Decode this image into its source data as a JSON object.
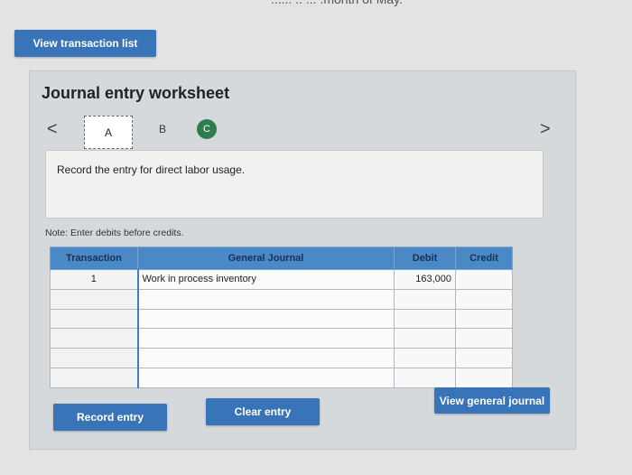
{
  "header": {
    "partial_text": "...... .. ... .month of May."
  },
  "view_list_button": "View transaction list",
  "worksheet": {
    "title": "Journal entry worksheet",
    "tabs": [
      "A",
      "B",
      "C"
    ],
    "prev_arrow": "<",
    "next_arrow": ">",
    "instruction": "Record the entry for direct labor usage.",
    "note": "Note: Enter debits before credits."
  },
  "table": {
    "headers": {
      "transaction": "Transaction",
      "journal": "General Journal",
      "debit": "Debit",
      "credit": "Credit"
    },
    "rows": [
      {
        "transaction": "1",
        "journal": "Work in process inventory",
        "debit": "163,000",
        "credit": ""
      },
      {
        "transaction": "",
        "journal": "",
        "debit": "",
        "credit": ""
      },
      {
        "transaction": "",
        "journal": "",
        "debit": "",
        "credit": ""
      },
      {
        "transaction": "",
        "journal": "",
        "debit": "",
        "credit": ""
      },
      {
        "transaction": "",
        "journal": "",
        "debit": "",
        "credit": ""
      },
      {
        "transaction": "",
        "journal": "",
        "debit": "",
        "credit": ""
      }
    ]
  },
  "buttons": {
    "record": "Record entry",
    "clear": "Clear entry",
    "view_general": "View general journal"
  },
  "colors": {
    "accent": "#3a74b8",
    "header_blue": "#4a88c6",
    "tab_c_green": "#2e7d4f"
  }
}
